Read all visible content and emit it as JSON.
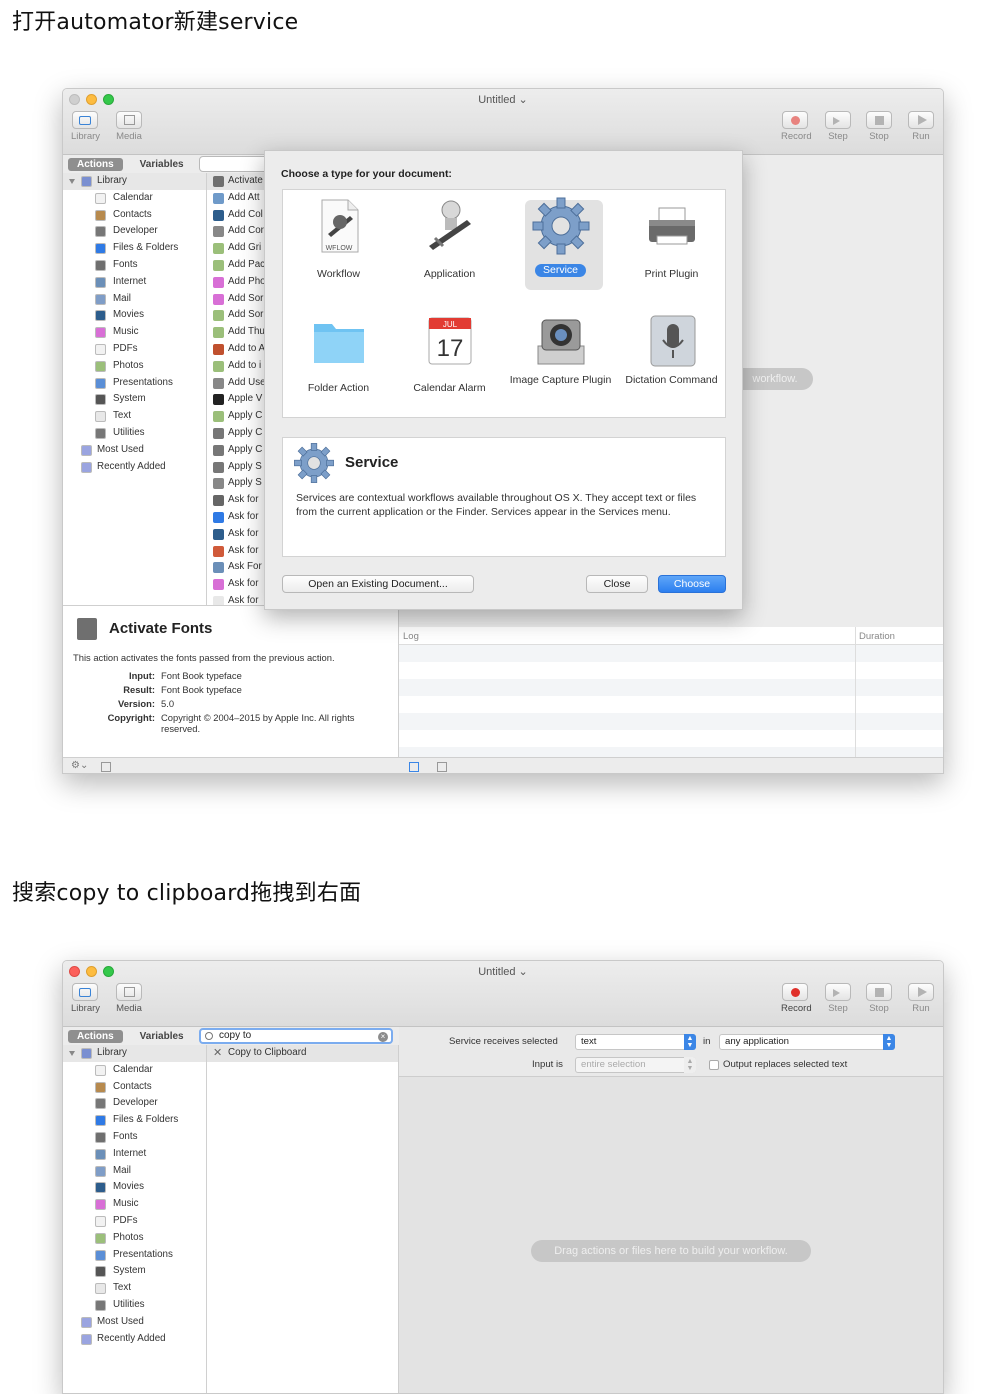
{
  "headings": {
    "step1": "打开automator新建service",
    "step2": "搜索copy to clipboard拖拽到右面"
  },
  "window": {
    "title": "Untitled",
    "toolbar": {
      "library": "Library",
      "media": "Media",
      "record": "Record",
      "step": "Step",
      "stop": "Stop",
      "run": "Run"
    },
    "tabs": {
      "actions": "Actions",
      "variables": "Variables"
    },
    "library_items": [
      {
        "label": "Library",
        "icon": "library-folder-icon"
      },
      {
        "label": "Calendar",
        "icon": "calendar-icon"
      },
      {
        "label": "Contacts",
        "icon": "contacts-icon"
      },
      {
        "label": "Developer",
        "icon": "developer-icon"
      },
      {
        "label": "Files & Folders",
        "icon": "files-folders-icon"
      },
      {
        "label": "Fonts",
        "icon": "fonts-icon"
      },
      {
        "label": "Internet",
        "icon": "internet-icon"
      },
      {
        "label": "Mail",
        "icon": "mail-icon"
      },
      {
        "label": "Movies",
        "icon": "movies-icon"
      },
      {
        "label": "Music",
        "icon": "music-icon"
      },
      {
        "label": "PDFs",
        "icon": "pdf-icon"
      },
      {
        "label": "Photos",
        "icon": "photos-icon"
      },
      {
        "label": "Presentations",
        "icon": "presentations-icon"
      },
      {
        "label": "System",
        "icon": "system-icon"
      },
      {
        "label": "Text",
        "icon": "text-icon"
      },
      {
        "label": "Utilities",
        "icon": "utilities-icon"
      },
      {
        "label": "Most Used",
        "icon": "smart-folder-icon"
      },
      {
        "label": "Recently Added",
        "icon": "smart-folder-icon"
      }
    ]
  },
  "window1": {
    "actions": [
      "Activate",
      "Add Att",
      "Add Col",
      "Add Cor",
      "Add Gri",
      "Add Pac",
      "Add Pho",
      "Add Sor",
      "Add Sor",
      "Add Thu",
      "Add to A",
      "Add to i",
      "Add Use",
      "Apple V",
      "Apply C",
      "Apply C",
      "Apply C",
      "Apply S",
      "Apply S",
      "Ask for",
      "Ask for",
      "Ask for",
      "Ask for",
      "Ask For",
      "Ask for",
      "Ask for"
    ],
    "description": {
      "title": "Activate Fonts",
      "summary": "This action activates the fonts passed from the previous action.",
      "input_label": "Input:",
      "input_value": "Font Book typeface",
      "result_label": "Result:",
      "result_value": "Font Book typeface",
      "version_label": "Version:",
      "version_value": "5.0",
      "copyright_label": "Copyright:",
      "copyright_value": "Copyright © 2004–2015 by Apple Inc. All rights reserved."
    },
    "log": {
      "log_header": "Log",
      "duration_header": "Duration"
    },
    "background_hint": "workflow."
  },
  "dialog": {
    "heading": "Choose a type for your document:",
    "types": [
      {
        "label": "Workflow",
        "icon": "workflow-icon",
        "badge": "WFLOW"
      },
      {
        "label": "Application",
        "icon": "application-icon"
      },
      {
        "label": "Service",
        "icon": "service-gear-icon",
        "selected": true
      },
      {
        "label": "Print Plugin",
        "icon": "printer-icon"
      },
      {
        "label": "Folder Action",
        "icon": "folder-icon"
      },
      {
        "label": "Calendar Alarm",
        "icon": "calendar-alarm-icon",
        "month": "JUL",
        "day": "17"
      },
      {
        "label": "Image Capture Plugin",
        "icon": "camera-icon"
      },
      {
        "label": "Dictation Command",
        "icon": "microphone-icon"
      }
    ],
    "info_title": "Service",
    "info_text": "Services are contextual workflows available throughout OS X. They accept text or files from the current application or the Finder. Services appear in the Services menu.",
    "open_existing": "Open an Existing Document...",
    "close": "Close",
    "choose": "Choose"
  },
  "window2": {
    "search_value": "copy to",
    "result": "Copy to Clipboard",
    "receives_label": "Service receives selected",
    "receives_value": "text",
    "in_label": "in",
    "in_value": "any application",
    "input_is_label": "Input is",
    "input_is_value": "entire selection",
    "output_replaces": "Output replaces selected text",
    "drop_hint": "Drag actions or files here to build your workflow."
  },
  "colors": {
    "red_light": "#fc605b",
    "yellow_light": "#fdbc40",
    "green_light": "#34c84a",
    "accent": "#3b86e6",
    "record_red": "#e0302a"
  }
}
